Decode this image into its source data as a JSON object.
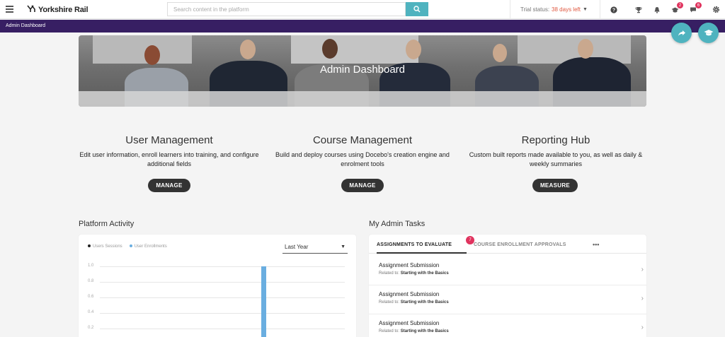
{
  "topbar": {
    "logo_text": "Yorkshire Rail",
    "search_placeholder": "Search content in the platform",
    "trial_label": "Trial status:",
    "trial_days": "38 days left",
    "notifications_count": "2",
    "messages_count": "6"
  },
  "subbar": {
    "title": "Admin Dashboard"
  },
  "hero": {
    "title": "Admin Dashboard"
  },
  "features": [
    {
      "title": "User Management",
      "description": "Edit user information, enroll learners into training, and configure additional fields",
      "button": "MANAGE"
    },
    {
      "title": "Course Management",
      "description": "Build and deploy courses using Docebo's creation engine and enrolment tools",
      "button": "MANAGE"
    },
    {
      "title": "Reporting Hub",
      "description": "Custom built reports made available to you, as well as daily & weekly summaries",
      "button": "MEASURE"
    }
  ],
  "platform_activity": {
    "title": "Platform Activity",
    "period": "Last Year",
    "legend": [
      {
        "label": "Users Sessions",
        "color": "#222222"
      },
      {
        "label": "User Enrollments",
        "color": "#6aaee0"
      }
    ],
    "chart_data": {
      "type": "bar",
      "ylim": [
        0,
        1.0
      ],
      "yticks": [
        "1.0",
        "0.8",
        "0.6",
        "0.4",
        "0.2"
      ],
      "series": [
        {
          "name": "User Enrollments",
          "values": [
            1.0
          ]
        }
      ]
    }
  },
  "admin_tasks": {
    "title": "My Admin Tasks",
    "tabs": [
      {
        "label": "ASSIGNMENTS TO EVALUATE",
        "badge": "7"
      },
      {
        "label": "COURSE ENROLLMENT APPROVALS"
      }
    ],
    "more": "•••",
    "related_label": "Related to:",
    "items": [
      {
        "title": "Assignment Submission",
        "related": "Starting with the Basics"
      },
      {
        "title": "Assignment Submission",
        "related": "Starting with the Basics"
      },
      {
        "title": "Assignment Submission",
        "related": "Starting with the Basics"
      }
    ]
  },
  "colors": {
    "accent": "#4fb3bf",
    "brand_bar": "#371f63",
    "badge": "#e0335e",
    "trial_days": "#e0573f"
  }
}
